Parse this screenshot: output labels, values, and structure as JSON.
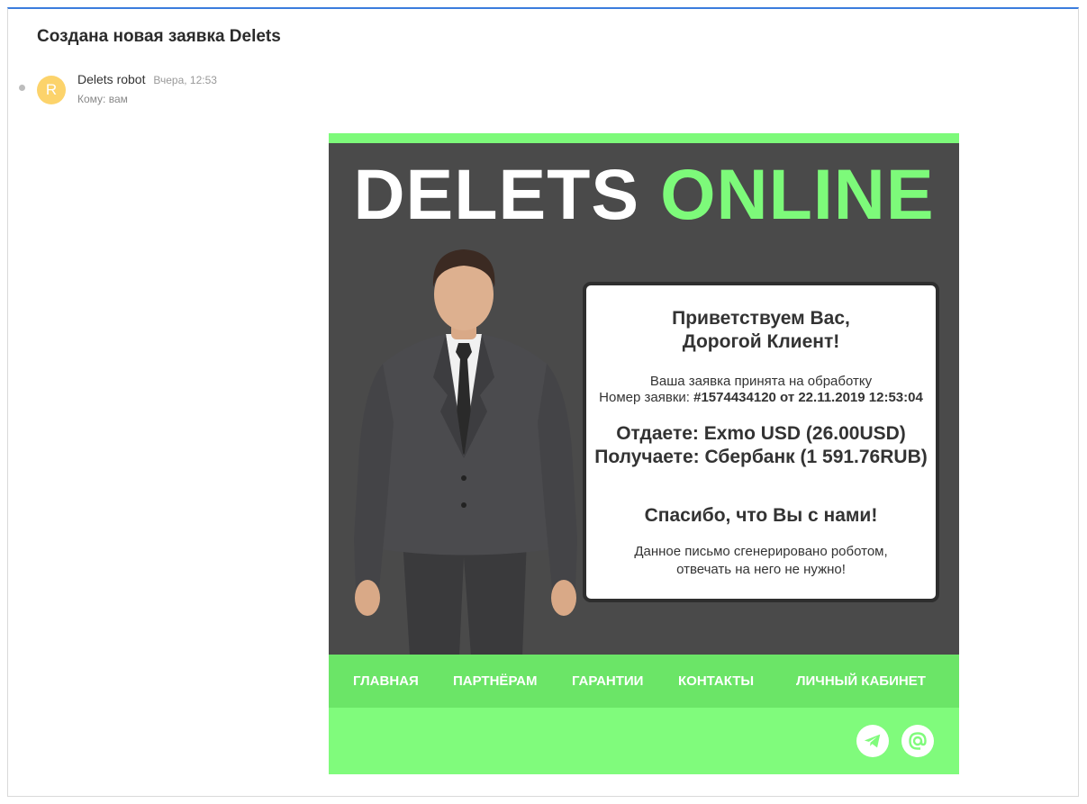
{
  "message": {
    "subject": "Создана новая заявка Delets",
    "sender_initial": "R",
    "sender_name": "Delets robot",
    "sent_time": "Вчера, 12:53",
    "recipient": "Кому: вам"
  },
  "email": {
    "brand_white": "DELETS",
    "brand_green": "ONLINE",
    "card": {
      "greet_line1": "Приветствуем Вас,",
      "greet_line2": "Дорогой Клиент!",
      "accepted": "Ваша заявка принята на обработку",
      "order_label": "Номер заявки: ",
      "order_value": "#1574434120 от 22.11.2019 12:53:04",
      "give": "Отдаете: Exmo USD (26.00USD)",
      "get": "Получаете: Сбербанк (1 591.76RUB)",
      "thanks": "Спасибо, что Вы с нами!",
      "note_line1": "Данное письмо сгенерировано роботом,",
      "note_line2": "отвечать на него не нужно!"
    },
    "nav": [
      "ГЛАВНАЯ",
      "ПАРТНЁРАМ",
      "ГАРАНТИИ",
      "КОНТАКТЫ",
      "ЛИЧНЫЙ КАБИНЕТ"
    ],
    "social_icons": [
      "telegram-icon",
      "email-at-icon"
    ]
  },
  "colors": {
    "accent_green": "#7dfa7a",
    "nav_green": "#6be567",
    "hero_dark": "#4a4a4a",
    "avatar": "#fcd36b"
  }
}
